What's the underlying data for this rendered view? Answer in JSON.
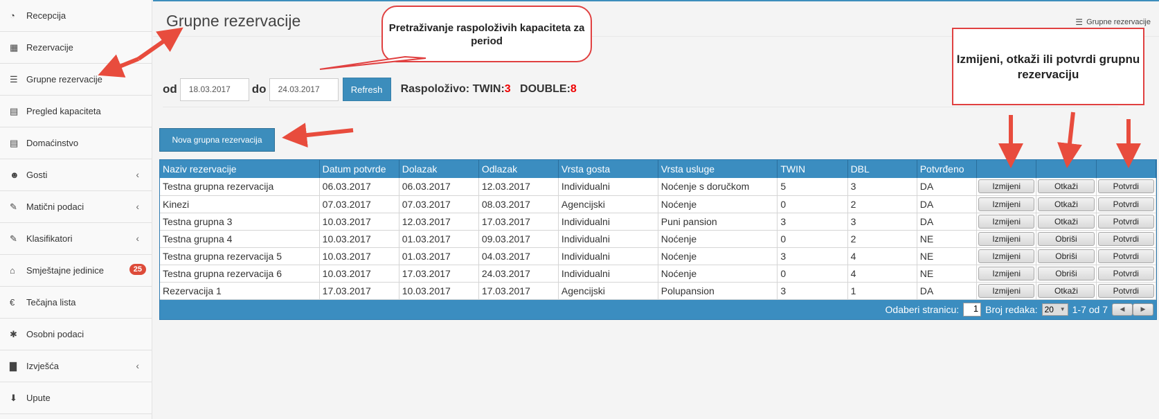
{
  "sidebar": {
    "items": [
      {
        "label": "Recepcija",
        "icon": "dashboard-icon",
        "glyph": "◔"
      },
      {
        "label": "Rezervacije",
        "icon": "grid-icon",
        "glyph": "▦"
      },
      {
        "label": "Grupne rezervacije",
        "icon": "list-icon",
        "glyph": "☰"
      },
      {
        "label": "Pregled kapaciteta",
        "icon": "calendar-icon",
        "glyph": "▤"
      },
      {
        "label": "Domaćinstvo",
        "icon": "list-alt-icon",
        "glyph": "▤"
      },
      {
        "label": "Gosti",
        "icon": "users-icon",
        "glyph": "☻",
        "chevron": "‹"
      },
      {
        "label": "Matični podaci",
        "icon": "edit-icon",
        "glyph": "✎",
        "chevron": "‹"
      },
      {
        "label": "Klasifikatori",
        "icon": "edit-icon",
        "glyph": "✎",
        "chevron": "‹"
      },
      {
        "label": "Smještajne jedinice",
        "icon": "home-icon",
        "glyph": "⌂",
        "badge": "25"
      },
      {
        "label": "Tečajna lista",
        "icon": "euro-icon",
        "glyph": "€"
      },
      {
        "label": "Osobni podaci",
        "icon": "asterisk-icon",
        "glyph": "✱"
      },
      {
        "label": "Izvješća",
        "icon": "bar-chart-icon",
        "glyph": "▇",
        "chevron": "‹"
      },
      {
        "label": "Upute",
        "icon": "download-icon",
        "glyph": "⬇"
      }
    ]
  },
  "header": {
    "title": "Grupne rezervacije",
    "breadcrumb": "Grupne rezervacije",
    "breadcrumb_icon": "list-icon"
  },
  "filter": {
    "from_label": "od",
    "from_value": "18.03.2017",
    "to_label": "do",
    "to_value": "24.03.2017",
    "refresh_label": "Refresh",
    "available_label": "Raspoloživo:",
    "twin_label": "TWIN:",
    "twin_value": "3",
    "double_label": "DOUBLE:",
    "double_value": "8"
  },
  "new_button": "Nova grupna rezervacija",
  "grid": {
    "columns": [
      "Naziv rezervacije",
      "Datum potvrde",
      "Dolazak",
      "Odlazak",
      "Vrsta gosta",
      "Vrsta usluge",
      "TWIN",
      "DBL",
      "Potvrđeno",
      "",
      "",
      ""
    ],
    "rows": [
      {
        "name": "Testna grupna rezervacija",
        "confirmed_date": "06.03.2017",
        "arrival": "06.03.2017",
        "departure": "12.03.2017",
        "guest_type": "Individualni",
        "service": "Noćenje s doručkom",
        "twin": "5",
        "dbl": "3",
        "confirmed": "DA",
        "btn1": "Izmijeni",
        "btn2": "Otkaži",
        "btn3": "Potvrdi"
      },
      {
        "name": "Kinezi",
        "confirmed_date": "07.03.2017",
        "arrival": "07.03.2017",
        "departure": "08.03.2017",
        "guest_type": "Agencijski",
        "service": "Noćenje",
        "twin": "0",
        "dbl": "2",
        "confirmed": "DA",
        "btn1": "Izmijeni",
        "btn2": "Otkaži",
        "btn3": "Potvrdi"
      },
      {
        "name": "Testna grupna 3",
        "confirmed_date": "10.03.2017",
        "arrival": "12.03.2017",
        "departure": "17.03.2017",
        "guest_type": "Individualni",
        "service": "Puni pansion",
        "twin": "3",
        "dbl": "3",
        "confirmed": "DA",
        "btn1": "Izmijeni",
        "btn2": "Otkaži",
        "btn3": "Potvrdi"
      },
      {
        "name": "Testna grupna 4",
        "confirmed_date": "10.03.2017",
        "arrival": "01.03.2017",
        "departure": "09.03.2017",
        "guest_type": "Individualni",
        "service": "Noćenje",
        "twin": "0",
        "dbl": "2",
        "confirmed": "NE",
        "btn1": "Izmijeni",
        "btn2": "Obriši",
        "btn3": "Potvrdi"
      },
      {
        "name": "Testna grupna rezervacija 5",
        "confirmed_date": "10.03.2017",
        "arrival": "01.03.2017",
        "departure": "04.03.2017",
        "guest_type": "Individualni",
        "service": "Noćenje",
        "twin": "3",
        "dbl": "4",
        "confirmed": "NE",
        "btn1": "Izmijeni",
        "btn2": "Obriši",
        "btn3": "Potvrdi"
      },
      {
        "name": "Testna grupna rezervacija 6",
        "confirmed_date": "10.03.2017",
        "arrival": "17.03.2017",
        "departure": "24.03.2017",
        "guest_type": "Individualni",
        "service": "Noćenje",
        "twin": "0",
        "dbl": "4",
        "confirmed": "NE",
        "btn1": "Izmijeni",
        "btn2": "Obriši",
        "btn3": "Potvrdi"
      },
      {
        "name": "Rezervacija 1",
        "confirmed_date": "17.03.2017",
        "arrival": "10.03.2017",
        "departure": "17.03.2017",
        "guest_type": "Agencijski",
        "service": "Polupansion",
        "twin": "3",
        "dbl": "1",
        "confirmed": "DA",
        "btn1": "Izmijeni",
        "btn2": "Otkaži",
        "btn3": "Potvrdi"
      }
    ],
    "pager": {
      "page_label": "Odaberi stranicu:",
      "page_value": "1",
      "rows_label": "Broj redaka:",
      "rows_value": "20",
      "range": "1-7 od 7"
    }
  },
  "annotations": {
    "search_callout": "Pretraživanje raspoloživih kapaciteta za period",
    "actions_callout": "Izmijeni, otkaži ili potvrdi grupnu rezervaciju",
    "arrow_color": "#e84c3d"
  }
}
